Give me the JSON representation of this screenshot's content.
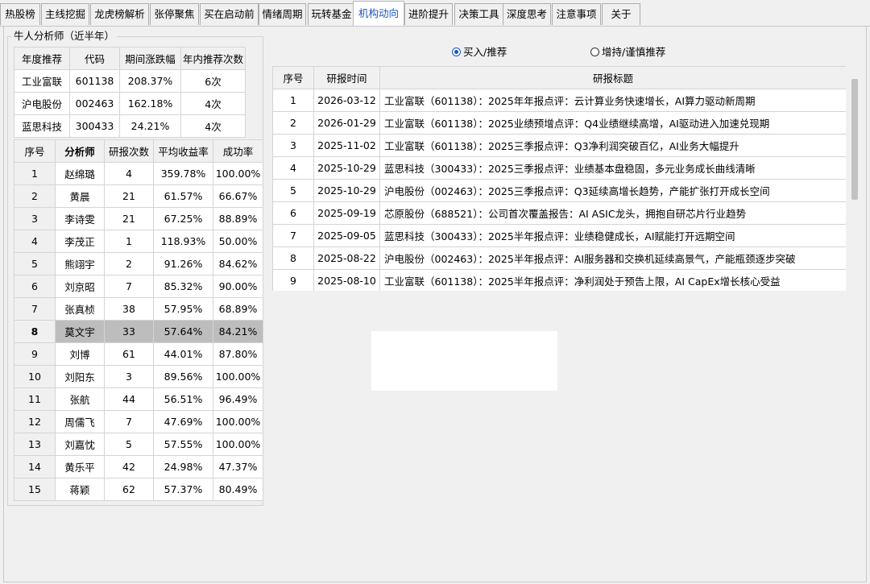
{
  "tabs": [
    "热股榜",
    "主线挖掘",
    "龙虎榜解析",
    "张停聚焦",
    "买在启动前",
    "情绪周期",
    "玩转基金",
    "机构动向",
    "进阶提升",
    "决策工具",
    "深度思考",
    "注意事项",
    "关于"
  ],
  "active_tab": "机构动向",
  "group": {
    "title": "牛人分析师（近半年）",
    "year_table": {
      "headers": [
        "年度推荐",
        "代码",
        "期间涨跌幅",
        "年内推荐次数"
      ],
      "rows": [
        [
          "工业富联",
          "601138",
          "208.37%",
          "6次"
        ],
        [
          "沪电股份",
          "002463",
          "162.18%",
          "4次"
        ],
        [
          "蓝思科技",
          "300433",
          "24.21%",
          "4次"
        ]
      ]
    },
    "analyst_table": {
      "headers": [
        "序号",
        "分析师",
        "研报次数",
        "平均收益率",
        "成功率"
      ],
      "selected_row": 8,
      "rows": [
        [
          "1",
          "赵绵璐",
          "4",
          "359.78%",
          "100.00%"
        ],
        [
          "2",
          "黄晨",
          "21",
          "61.57%",
          "66.67%"
        ],
        [
          "3",
          "李诗雯",
          "21",
          "67.25%",
          "88.89%"
        ],
        [
          "4",
          "李茂正",
          "1",
          "118.93%",
          "50.00%"
        ],
        [
          "5",
          "熊翊宇",
          "2",
          "91.26%",
          "84.62%"
        ],
        [
          "6",
          "刘京昭",
          "7",
          "85.32%",
          "90.00%"
        ],
        [
          "7",
          "张真桢",
          "38",
          "57.95%",
          "68.89%"
        ],
        [
          "8",
          "莫文宇",
          "33",
          "57.64%",
          "84.21%"
        ],
        [
          "9",
          "刘博",
          "61",
          "44.01%",
          "87.80%"
        ],
        [
          "10",
          "刘阳东",
          "3",
          "89.56%",
          "100.00%"
        ],
        [
          "11",
          "张航",
          "44",
          "56.51%",
          "96.49%"
        ],
        [
          "12",
          "周儒飞",
          "7",
          "47.69%",
          "100.00%"
        ],
        [
          "13",
          "刘嘉忱",
          "5",
          "57.55%",
          "100.00%"
        ],
        [
          "14",
          "黄乐平",
          "42",
          "24.98%",
          "47.37%"
        ],
        [
          "15",
          "蒋颖",
          "62",
          "57.37%",
          "80.49%"
        ]
      ]
    }
  },
  "radio": {
    "option1": "买入/推荐",
    "option2": "增持/谨慎推荐",
    "selected": "option1"
  },
  "report_table": {
    "headers": [
      "序号",
      "研报时间",
      "研报标题"
    ],
    "rows": [
      [
        "1",
        "2026-03-12",
        "工业富联（601138）：2025年年报点评：云计算业务快速增长，AI算力驱动新周期"
      ],
      [
        "2",
        "2026-01-29",
        "工业富联（601138）：2025业绩预增点评：Q4业绩继续高增，AI驱动进入加速兑现期"
      ],
      [
        "3",
        "2025-11-02",
        "工业富联（601138）：2025三季报点评：Q3净利润突破百亿，AI业务大幅提升"
      ],
      [
        "4",
        "2025-10-29",
        "蓝思科技（300433）：2025三季报点评：业绩基本盘稳固，多元业务成长曲线清晰"
      ],
      [
        "5",
        "2025-10-29",
        "沪电股份（002463）：2025三季报点评：Q3延续高增长趋势，产能扩张打开成长空间"
      ],
      [
        "6",
        "2025-09-19",
        "芯原股份（688521）：公司首次覆盖报告：AI ASIC龙头，拥抱自研芯片行业趋势"
      ],
      [
        "7",
        "2025-09-05",
        "蓝思科技（300433）：2025半年报点评：业绩稳健成长，AI赋能打开远期空间"
      ],
      [
        "8",
        "2025-08-22",
        "沪电股份（002463）：2025半年报点评：AI服务器和交换机延续高景气，产能瓶颈逐步突破"
      ],
      [
        "9",
        "2025-08-10",
        "工业富联（601138）：2025半年报点评：净利润处于预告上限，AI CapEx增长核心受益"
      ]
    ]
  }
}
